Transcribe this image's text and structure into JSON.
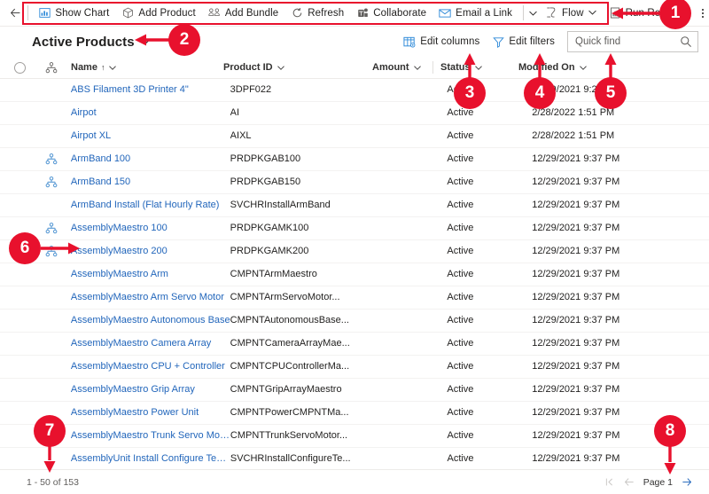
{
  "commandbar": {
    "back_label": "←",
    "items": [
      {
        "label": "Show Chart",
        "icon": "show-chart-icon",
        "caret": false
      },
      {
        "label": "Add Product",
        "icon": "add-product-icon",
        "caret": false
      },
      {
        "label": "Add Bundle",
        "icon": "add-bundle-icon",
        "caret": false
      },
      {
        "label": "Refresh",
        "icon": "refresh-icon",
        "caret": false
      },
      {
        "label": "Collaborate",
        "icon": "collaborate-icon",
        "caret": false
      },
      {
        "label": "Email a Link",
        "icon": "email-link-icon",
        "caret": false
      }
    ],
    "items_after": [
      {
        "label": "Flow",
        "icon": "flow-icon",
        "caret": true
      },
      {
        "label": "Run Report",
        "icon": "run-report-icon",
        "caret": true
      }
    ],
    "standalone_caret": "∨",
    "overflow_label": "More commands"
  },
  "viewbar": {
    "title": "Active Products",
    "title_caret": "∨",
    "edit_columns": "Edit columns",
    "edit_filters": "Edit filters"
  },
  "search": {
    "placeholder": "Quick find",
    "value": "",
    "icon": "search-icon"
  },
  "grid": {
    "headers": {
      "select_all": "",
      "hierarchy": "",
      "name": "Name",
      "name_sort": "↑",
      "product_id": "Product ID",
      "amount": "Amount",
      "status": "Status",
      "modified_on": "Modified On"
    },
    "header_caret": "∨",
    "rows": [
      {
        "hierarchy": false,
        "name": "ABS Filament 3D Printer 4\"",
        "product_id": "3DPF022",
        "amount": "",
        "status": "Active",
        "modified_on": "12/29/2021 9:22 PM"
      },
      {
        "hierarchy": false,
        "name": "Airpot",
        "product_id": "AI",
        "amount": "",
        "status": "Active",
        "modified_on": "2/28/2022 1:51 PM"
      },
      {
        "hierarchy": false,
        "name": "Airpot XL",
        "product_id": "AIXL",
        "amount": "",
        "status": "Active",
        "modified_on": "2/28/2022 1:51 PM"
      },
      {
        "hierarchy": true,
        "name": "ArmBand 100",
        "product_id": "PRDPKGAB100",
        "amount": "",
        "status": "Active",
        "modified_on": "12/29/2021 9:37 PM"
      },
      {
        "hierarchy": true,
        "name": "ArmBand 150",
        "product_id": "PRDPKGAB150",
        "amount": "",
        "status": "Active",
        "modified_on": "12/29/2021 9:37 PM"
      },
      {
        "hierarchy": false,
        "name": "ArmBand Install (Flat Hourly Rate)",
        "product_id": "SVCHRInstallArmBand",
        "amount": "",
        "status": "Active",
        "modified_on": "12/29/2021 9:37 PM"
      },
      {
        "hierarchy": true,
        "name": "AssemblyMaestro 100",
        "product_id": "PRDPKGAMK100",
        "amount": "",
        "status": "Active",
        "modified_on": "12/29/2021 9:37 PM"
      },
      {
        "hierarchy": true,
        "name": "AssemblyMaestro 200",
        "product_id": "PRDPKGAMK200",
        "amount": "",
        "status": "Active",
        "modified_on": "12/29/2021 9:37 PM"
      },
      {
        "hierarchy": false,
        "name": "AssemblyMaestro Arm",
        "product_id": "CMPNTArmMaestro",
        "amount": "",
        "status": "Active",
        "modified_on": "12/29/2021 9:37 PM"
      },
      {
        "hierarchy": false,
        "name": "AssemblyMaestro Arm Servo Motor",
        "product_id": "CMPNTArmServoMotor...",
        "amount": "",
        "status": "Active",
        "modified_on": "12/29/2021 9:37 PM"
      },
      {
        "hierarchy": false,
        "name": "AssemblyMaestro Autonomous Base",
        "product_id": "CMPNTAutonomousBase...",
        "amount": "",
        "status": "Active",
        "modified_on": "12/29/2021 9:37 PM"
      },
      {
        "hierarchy": false,
        "name": "AssemblyMaestro Camera Array",
        "product_id": "CMPNTCameraArrayMae...",
        "amount": "",
        "status": "Active",
        "modified_on": "12/29/2021 9:37 PM"
      },
      {
        "hierarchy": false,
        "name": "AssemblyMaestro CPU + Controller",
        "product_id": "CMPNTCPUControllerMa...",
        "amount": "",
        "status": "Active",
        "modified_on": "12/29/2021 9:37 PM"
      },
      {
        "hierarchy": false,
        "name": "AssemblyMaestro Grip Array",
        "product_id": "CMPNTGripArrayMaestro",
        "amount": "",
        "status": "Active",
        "modified_on": "12/29/2021 9:37 PM"
      },
      {
        "hierarchy": false,
        "name": "AssemblyMaestro Power Unit",
        "product_id": "CMPNTPowerCMPNTMa...",
        "amount": "",
        "status": "Active",
        "modified_on": "12/29/2021 9:37 PM"
      },
      {
        "hierarchy": false,
        "name": "AssemblyMaestro Trunk Servo Motor",
        "product_id": "CMPNTTrunkServoMotor...",
        "amount": "",
        "status": "Active",
        "modified_on": "12/29/2021 9:37 PM"
      },
      {
        "hierarchy": false,
        "name": "AssemblyUnit Install Configure Test (Flat ...",
        "product_id": "SVCHRInstallConfigureTe...",
        "amount": "",
        "status": "Active",
        "modified_on": "12/29/2021 9:37 PM"
      }
    ]
  },
  "footer": {
    "record_count": "1 - 50 of 153",
    "page_label": "Page 1",
    "first_icon": "page-first-icon",
    "prev_icon": "page-previous-icon",
    "next_icon": "page-next-icon"
  },
  "annotations": {
    "accent_color": "#e8112d",
    "badges": [
      "1",
      "2",
      "3",
      "4",
      "5",
      "6",
      "7",
      "8"
    ]
  }
}
